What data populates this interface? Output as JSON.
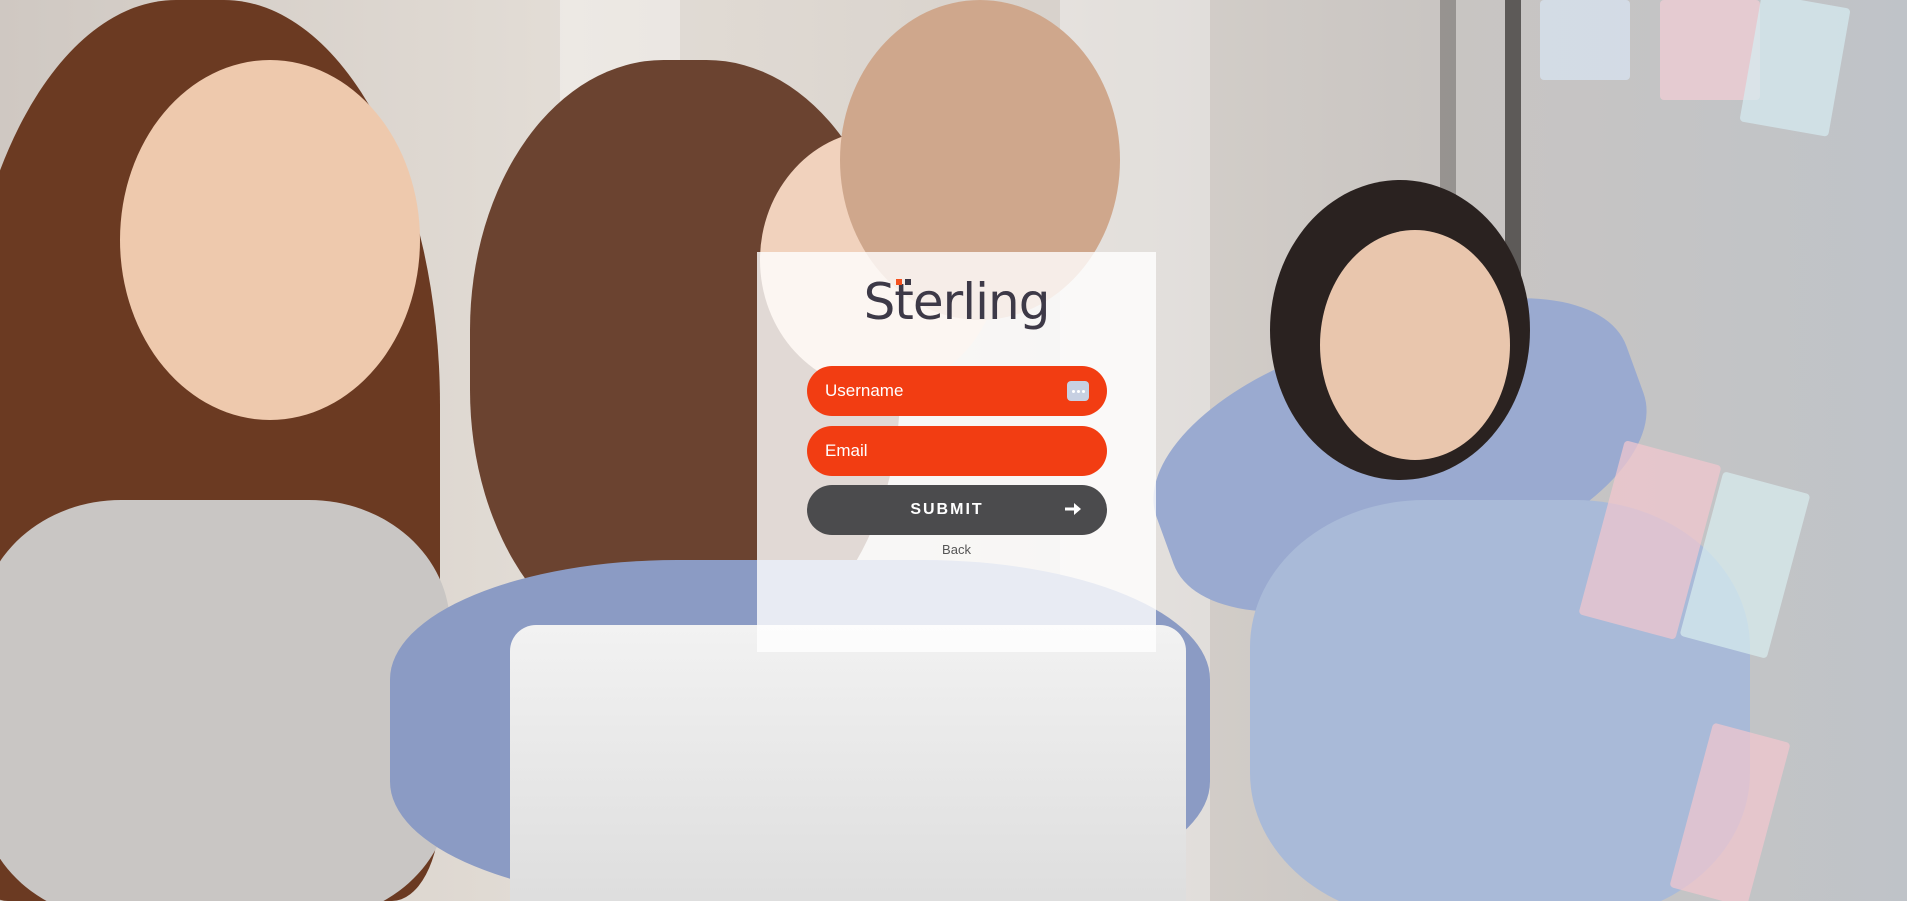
{
  "brand": {
    "logo_text": "Sterling",
    "accent_color": "#f23d12",
    "dark_color": "#3d3947"
  },
  "form": {
    "username": {
      "placeholder": "Username",
      "value": ""
    },
    "email": {
      "placeholder": "Email",
      "value": ""
    },
    "submit_label": "SUBMIT",
    "back_label": "Back"
  },
  "icons": {
    "field_menu": "dots-icon",
    "submit_arrow": "arrow-right-icon"
  },
  "background": {
    "description_icon": "team-photo"
  }
}
